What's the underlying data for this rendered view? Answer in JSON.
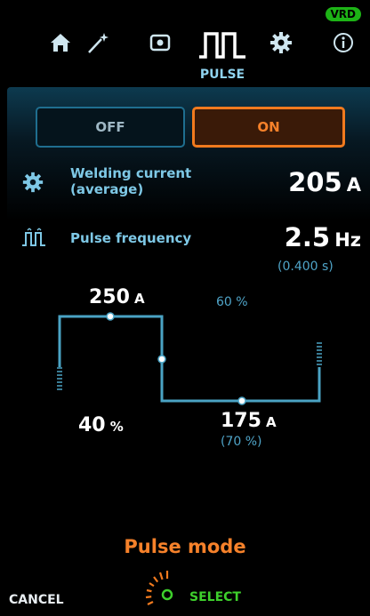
{
  "status": {
    "vrd_badge": "VRD"
  },
  "nav": {
    "items": [
      {
        "icon": "home-icon"
      },
      {
        "icon": "magic-wand-icon"
      },
      {
        "icon": "memory-card-icon"
      },
      {
        "icon": "pulse-wave-icon",
        "label": "PULSE",
        "active": true
      },
      {
        "icon": "gear-icon"
      },
      {
        "icon": "info-icon"
      }
    ]
  },
  "toggle": {
    "off_label": "OFF",
    "on_label": "ON",
    "selected": "ON"
  },
  "welding_current": {
    "label": "Welding current (average)",
    "value": "205",
    "unit": "A",
    "icon": "gear-icon"
  },
  "pulse_frequency": {
    "label": "Pulse frequency",
    "value": "2.5",
    "unit": "Hz",
    "period": "(0.400 s)",
    "icon": "pulse-wave-icon"
  },
  "pulse_graph": {
    "peak_current": "250",
    "peak_unit": "A",
    "peak_duty": "60 %",
    "base_current": "175",
    "base_unit": "A",
    "base_percent": "(70 %)",
    "low_duty": "40",
    "low_duty_unit": "%"
  },
  "footer": {
    "mode_title": "Pulse mode",
    "cancel_label": "CANCEL",
    "select_label": "SELECT"
  },
  "colors": {
    "accent": "#f6812a",
    "line": "#4aa3c4",
    "label": "#7ec8e6",
    "select": "#3ed02c"
  }
}
